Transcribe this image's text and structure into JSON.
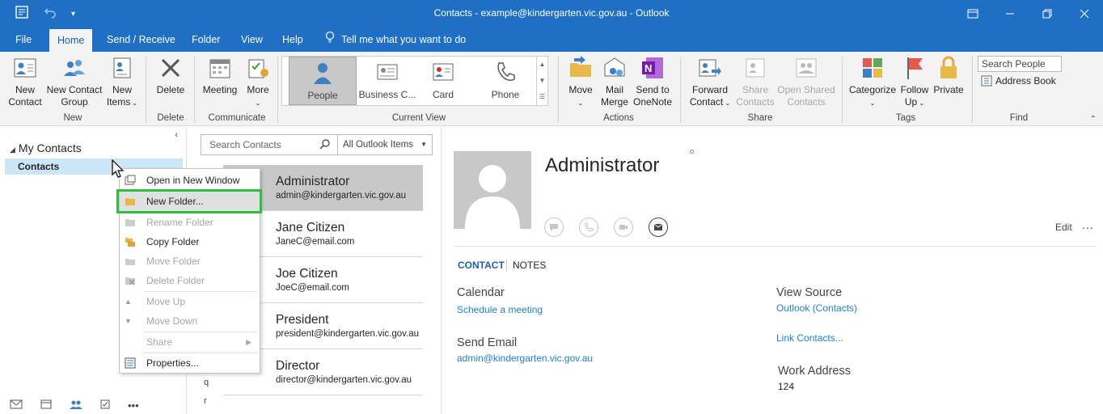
{
  "window": {
    "title": "Contacts - example@kindergarten.vic.gov.au  -  Outlook"
  },
  "tabs": [
    "File",
    "Home",
    "Send / Receive",
    "Folder",
    "View",
    "Help",
    "Tell me what you want to do"
  ],
  "ribbon": {
    "new_contact": "New Contact",
    "new_contact_l1": "New",
    "new_contact_l2": "Contact",
    "new_group_l1": "New Contact",
    "new_group_l2": "Group",
    "new_items_l1": "New",
    "new_items_l2": "Items",
    "group_new": "New",
    "delete": "Delete",
    "group_delete": "Delete",
    "meeting": "Meeting",
    "more": "More",
    "group_communicate": "Communicate",
    "views": [
      "People",
      "Business C...",
      "Card",
      "Phone"
    ],
    "group_current_view": "Current View",
    "move": "Move",
    "mail_merge_l1": "Mail",
    "mail_merge_l2": "Merge",
    "onenote_l1": "Send to",
    "onenote_l2": "OneNote",
    "group_actions": "Actions",
    "forward_l1": "Forward",
    "forward_l2": "Contact",
    "share_l1": "Share",
    "share_l2": "Contacts",
    "open_shared_l1": "Open Shared",
    "open_shared_l2": "Contacts",
    "group_share": "Share",
    "categorize": "Categorize",
    "follow_l1": "Follow",
    "follow_l2": "Up",
    "private": "Private",
    "group_tags": "Tags",
    "search_people_placeholder": "Search People",
    "address_book": "Address Book",
    "group_find": "Find"
  },
  "nav": {
    "my_contacts": "My Contacts",
    "contacts": "Contacts"
  },
  "context_menu": {
    "open_new_window": "Open in New Window",
    "new_folder": "New Folder...",
    "rename_folder": "Rename Folder",
    "copy_folder": "Copy Folder",
    "move_folder": "Move Folder",
    "delete_folder": "Delete Folder",
    "move_up": "Move Up",
    "move_down": "Move Down",
    "share": "Share",
    "properties": "Properties..."
  },
  "list": {
    "search_placeholder": "Search Contacts",
    "scope": "All Outlook Items",
    "letters": [
      "q",
      "r"
    ],
    "contacts": [
      {
        "name": "Administrator",
        "email": "admin@kindergarten.vic.gov.au"
      },
      {
        "name": "Jane Citizen",
        "email": "JaneC@email.com"
      },
      {
        "name": "Joe Citizen",
        "email": "JoeC@email.com"
      },
      {
        "name": "President",
        "email": "president@kindergarten.vic.gov.au"
      },
      {
        "name": "Director",
        "email": "director@kindergarten.vic.gov.au"
      }
    ]
  },
  "card": {
    "name": "Administrator",
    "edit": "Edit",
    "more": "...",
    "tab_contact": "CONTACT",
    "tab_notes": "NOTES",
    "calendar_label": "Calendar",
    "schedule_meeting": "Schedule a meeting",
    "send_email_label": "Send Email",
    "email": "admin@kindergarten.vic.gov.au",
    "view_source_label": "View Source",
    "view_source_value": "Outlook (Contacts)",
    "link_contacts": "Link Contacts...",
    "work_address_label": "Work Address",
    "work_address_value": "124"
  },
  "colors": {
    "titlebar": "#1f6fc5",
    "highlight_box": "#2dbf3f",
    "link": "#1f80c8",
    "selected_nav": "#cde6f7"
  }
}
